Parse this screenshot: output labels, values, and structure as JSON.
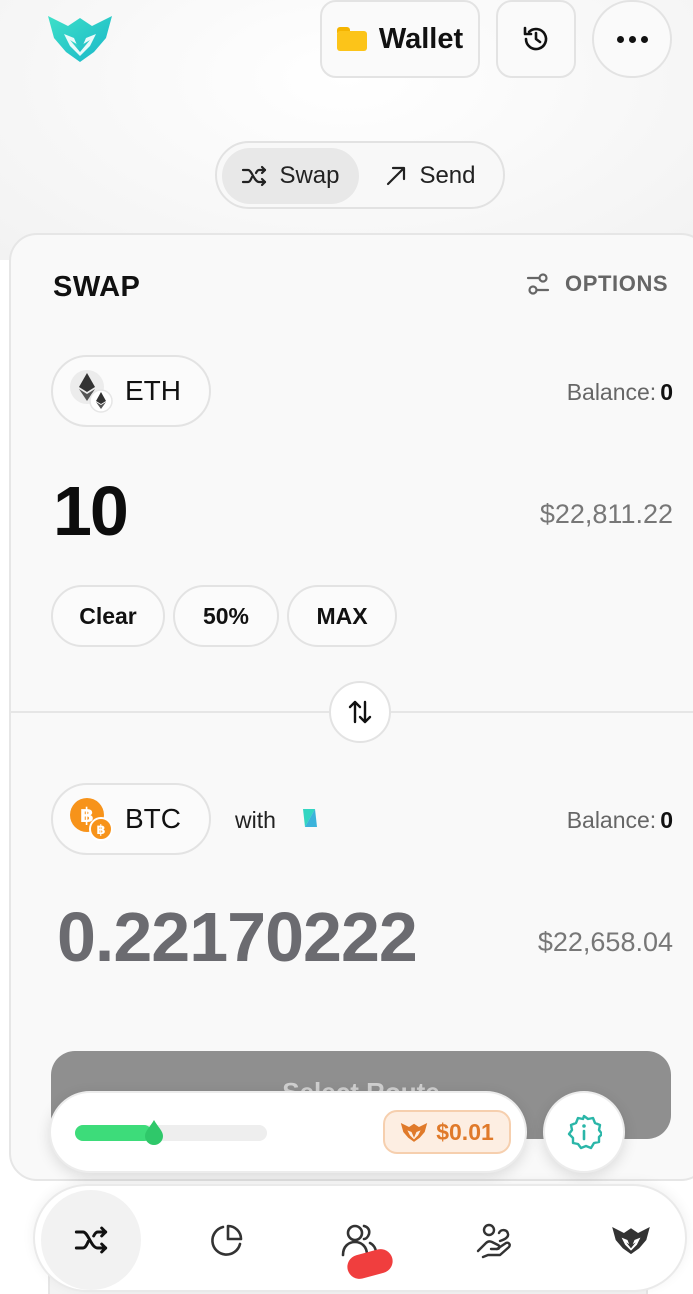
{
  "header": {
    "logo_icon": "lion-logo-icon",
    "wallet_label": "Wallet",
    "wallet_icon": "folder-icon",
    "history_icon": "history-icon",
    "more_icon": "more-icon"
  },
  "mode_toggle": {
    "tabs": [
      {
        "label": "Swap",
        "icon": "shuffle-icon",
        "active": true
      },
      {
        "label": "Send",
        "icon": "arrow-up-right-icon",
        "active": false
      }
    ]
  },
  "swap": {
    "title": "SWAP",
    "options_label": "OPTIONS",
    "from": {
      "token": "ETH",
      "balance_label": "Balance:",
      "balance_value": "0",
      "amount": "10",
      "usd_value": "$22,811.22"
    },
    "quick_amounts": [
      "Clear",
      "50%",
      "MAX"
    ],
    "to": {
      "token": "BTC",
      "with_label": "with",
      "balance_label": "Balance:",
      "balance_value": "0",
      "amount": "0.22170222",
      "usd_value": "$22,658.04"
    },
    "select_route_label": "Select Route"
  },
  "gas": {
    "progress": 0.4,
    "price": "$0.01"
  },
  "colors": {
    "brand_teal": "#2dd4bf",
    "progress_green": "#3ddc7a",
    "price_orange": "#e07a2a",
    "notification_red": "#f03e3e"
  },
  "bottom_nav": {
    "items": [
      "shuffle-icon",
      "pie-chart-icon",
      "users-icon",
      "handshake-icon",
      "lion-logo-icon"
    ],
    "active_index": 0
  }
}
